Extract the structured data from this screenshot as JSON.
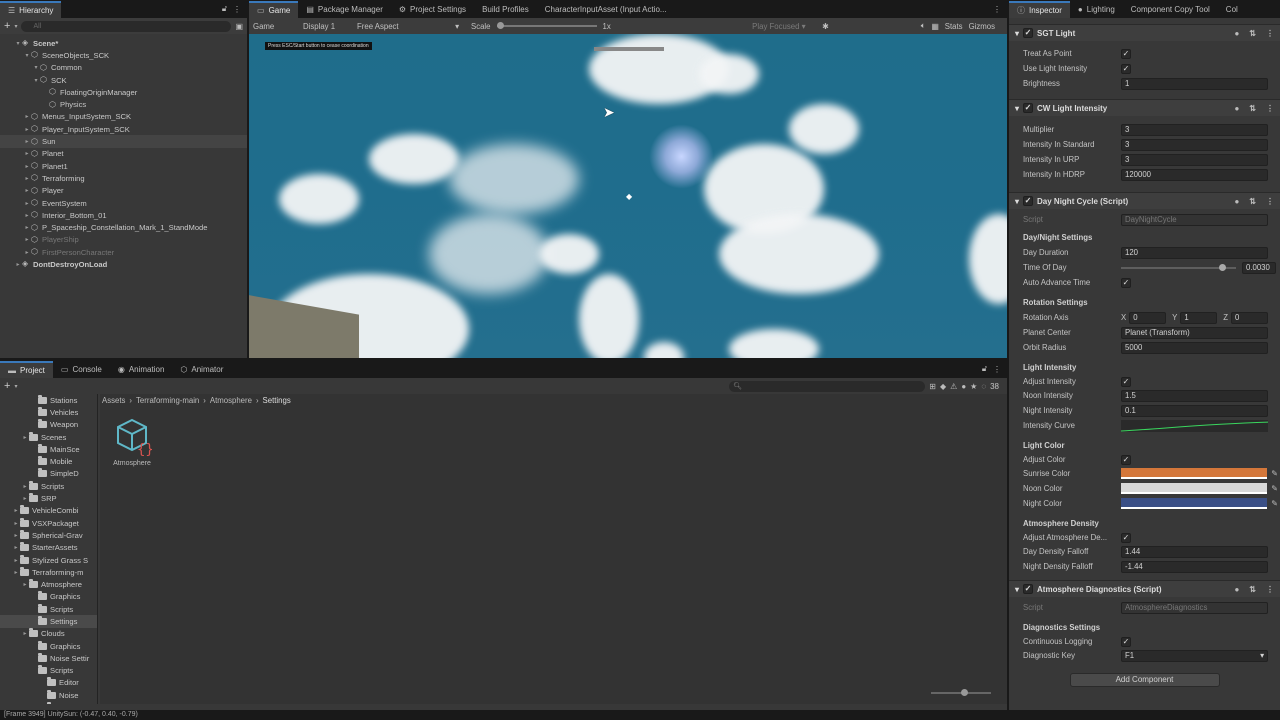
{
  "hierarchy": {
    "tab": "Hierarchy",
    "search_placeholder": "All",
    "items": [
      {
        "label": "Scene*",
        "depth": 0,
        "dim": false
      },
      {
        "label": "SceneObjects_SCK",
        "depth": 1,
        "dim": false
      },
      {
        "label": "Common",
        "depth": 2,
        "dim": false
      },
      {
        "label": "SCK",
        "depth": 2,
        "dim": false
      },
      {
        "label": "FloatingOriginManager",
        "depth": 3,
        "dim": false
      },
      {
        "label": "Physics",
        "depth": 3,
        "dim": false
      },
      {
        "label": "Menus_InputSystem_SCK",
        "depth": 1,
        "dim": false
      },
      {
        "label": "Player_InputSystem_SCK",
        "depth": 1,
        "dim": false
      },
      {
        "label": "Sun",
        "depth": 1,
        "dim": false
      },
      {
        "label": "Planet",
        "depth": 1,
        "dim": false
      },
      {
        "label": "Planet1",
        "depth": 1,
        "dim": false
      },
      {
        "label": "Terraforming",
        "depth": 1,
        "dim": false
      },
      {
        "label": "Player",
        "depth": 1,
        "dim": false
      },
      {
        "label": "EventSystem",
        "depth": 1,
        "dim": false
      },
      {
        "label": "Interior_Bottom_01",
        "depth": 1,
        "dim": false
      },
      {
        "label": "P_Spaceship_Constellation_Mark_1_StandMode",
        "depth": 1,
        "dim": false
      },
      {
        "label": "PlayerShip",
        "depth": 1,
        "dim": true
      },
      {
        "label": "FirstPersonCharacter",
        "depth": 1,
        "dim": true
      },
      {
        "label": "DontDestroyOnLoad",
        "depth": 0,
        "dim": false
      }
    ]
  },
  "top_tabs": [
    "Game",
    "Package Manager",
    "Project Settings",
    "Build Profiles",
    "CharacterInputAsset (Input Actio..."
  ],
  "game_toolbar": {
    "mode": "Game",
    "display": "Display 1",
    "aspect": "Free Aspect",
    "scale_label": "Scale",
    "scale_value": "1x",
    "play_focused": "Play Focused",
    "stats": "Stats",
    "gizmos": "Gizmos"
  },
  "game_view": {
    "overlay_text": "Press ESC/Start button to cease coordination"
  },
  "bottom_tabs": [
    "Project",
    "Console",
    "Animation",
    "Animator"
  ],
  "project": {
    "hidden_count": "38",
    "breadcrumb": [
      "Assets",
      "Terraforming-main",
      "Atmosphere",
      "Settings"
    ],
    "asset_name": "Atmosphere",
    "tree": [
      {
        "label": "Stations",
        "depth": 2
      },
      {
        "label": "Vehicles",
        "depth": 2
      },
      {
        "label": "Weapon",
        "depth": 2
      },
      {
        "label": "Scenes",
        "depth": 1
      },
      {
        "label": "MainSce",
        "depth": 2
      },
      {
        "label": "Mobile",
        "depth": 2
      },
      {
        "label": "SimpleD",
        "depth": 2
      },
      {
        "label": "Scripts",
        "depth": 1
      },
      {
        "label": "SRP",
        "depth": 1
      },
      {
        "label": "VehicleCombi",
        "depth": 0
      },
      {
        "label": "VSXPackaget",
        "depth": 0
      },
      {
        "label": "Spherical-Grav",
        "depth": 0
      },
      {
        "label": "StarterAssets",
        "depth": 0
      },
      {
        "label": "Stylized Grass S",
        "depth": 0
      },
      {
        "label": "Terraforming-m",
        "depth": 0
      },
      {
        "label": "Atmosphere",
        "depth": 1
      },
      {
        "label": "Graphics",
        "depth": 2
      },
      {
        "label": "Scripts",
        "depth": 2
      },
      {
        "label": "Settings",
        "depth": 2
      },
      {
        "label": "Clouds",
        "depth": 1
      },
      {
        "label": "Graphics",
        "depth": 2
      },
      {
        "label": "Noise Settir",
        "depth": 2
      },
      {
        "label": "Scripts",
        "depth": 2
      },
      {
        "label": "Editor",
        "depth": 3
      },
      {
        "label": "Noise",
        "depth": 3
      },
      {
        "label": "Shaders",
        "depth": 3
      }
    ]
  },
  "status_bar": "[Frame 3949] UnitySun: (-0.47, 0.40, -0.79)",
  "inspector": {
    "tabs": [
      "Inspector",
      "Lighting",
      "Component Copy Tool",
      "Col"
    ],
    "sgt_light": {
      "title": "SGT Light",
      "rows": [
        {
          "label": "Treat As Point",
          "type": "check",
          "value": "✓"
        },
        {
          "label": "Use Light Intensity",
          "type": "check",
          "value": "✓"
        },
        {
          "label": "Brightness",
          "type": "field",
          "value": "1"
        }
      ]
    },
    "cw_light": {
      "title": "CW Light Intensity",
      "rows": [
        {
          "label": "Multiplier",
          "value": "3"
        },
        {
          "label": "Intensity In Standard",
          "value": "3"
        },
        {
          "label": "Intensity In URP",
          "value": "3"
        },
        {
          "label": "Intensity In HDRP",
          "value": "120000"
        }
      ]
    },
    "day_night": {
      "title": "Day Night Cycle (Script)",
      "script_label": "Script",
      "script_value": "DayNightCycle",
      "settings_title": "Day/Night Settings",
      "day_duration_label": "Day Duration",
      "day_duration": "120",
      "time_of_day_label": "Time Of Day",
      "time_of_day": "0.0030",
      "time_of_day_fraction": 0.85,
      "auto_advance_label": "Auto Advance Time",
      "auto_advance": "✓",
      "rotation_title": "Rotation Settings",
      "rotation_axis_label": "Rotation Axis",
      "axis_x": "0",
      "axis_y": "1",
      "axis_z": "0",
      "x_label": "X",
      "y_label": "Y",
      "z_label": "Z",
      "planet_center_label": "Planet Center",
      "planet_center": "Planet (Transform)",
      "orbit_radius_label": "Orbit Radius",
      "orbit_radius": "5000",
      "light_intensity_title": "Light Intensity",
      "adjust_intensity_label": "Adjust Intensity",
      "adjust_intensity": "✓",
      "noon_intensity_label": "Noon Intensity",
      "noon_intensity": "1.5",
      "night_intensity_label": "Night Intensity",
      "night_intensity": "0.1",
      "intensity_curve_label": "Intensity Curve",
      "light_color_title": "Light Color",
      "adjust_color_label": "Adjust Color",
      "adjust_color": "✓",
      "sunrise_label": "Sunrise Color",
      "sunrise_color": "#d4773a",
      "noon_label": "Noon Color",
      "noon_color": "#d8d8d8",
      "night_label": "Night Color",
      "night_color": "#3a4f86",
      "density_title": "Atmosphere Density",
      "adjust_density_label": "Adjust Atmosphere De...",
      "adjust_density": "✓",
      "day_falloff_label": "Day Density Falloff",
      "day_falloff": "1.44",
      "night_falloff_label": "Night Density Falloff",
      "night_falloff": "-1.44"
    },
    "diagnostics": {
      "title": "Atmosphere Diagnostics (Script)",
      "script_label": "Script",
      "script_value": "AtmosphereDiagnostics",
      "settings_title": "Diagnostics Settings",
      "continuous_label": "Continuous Logging",
      "continuous": "✓",
      "key_label": "Diagnostic Key",
      "key_value": "F1"
    },
    "add_component": "Add Component"
  }
}
